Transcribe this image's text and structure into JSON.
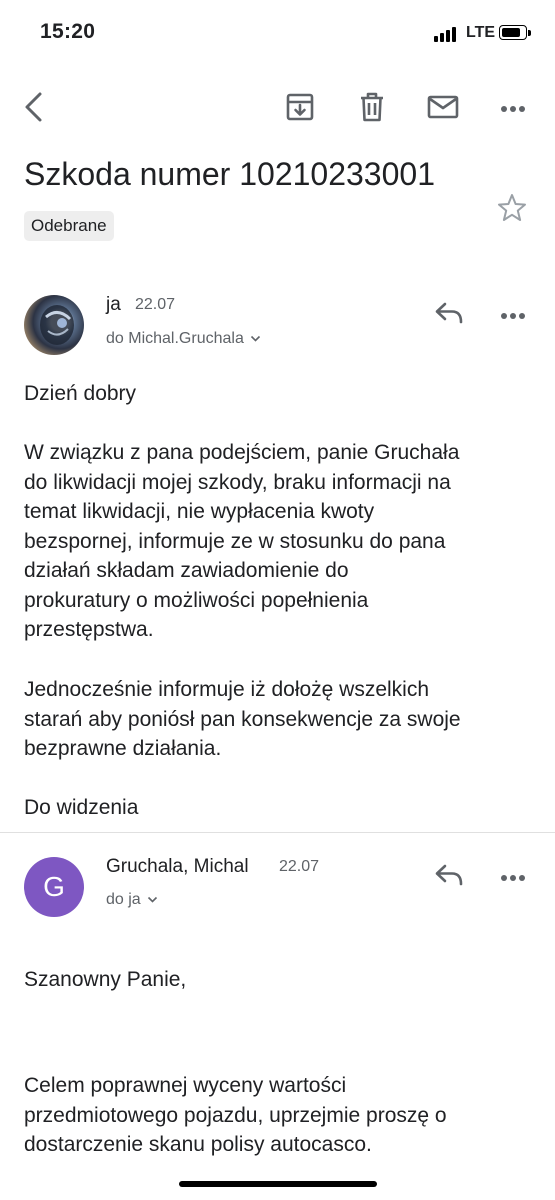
{
  "status_bar": {
    "time": "15:20",
    "network": "LTE",
    "battery_level": 0.85
  },
  "toolbar": {
    "icons": [
      "back-arrow-icon",
      "archive-icon",
      "delete-icon",
      "mark-unread-icon",
      "more-icon"
    ]
  },
  "subject": "Szkoda numer 10210233001",
  "label": "Odebrane",
  "messages": [
    {
      "sender": "ja",
      "date": "22.07",
      "recipient": "do Michal.Gruchala",
      "avatar": "photo",
      "paragraphs": [
        [
          "Dzień dobry"
        ],
        [
          "W związku z pana podejściem, panie Gruchała",
          "do likwidacji mojej szkody, braku informacji na",
          "temat likwidacji, nie wypłacenia kwoty",
          "bezspornej, informuje ze w stosunku do pana",
          "działań składam zawiadomienie do",
          "prokuratury o możliwości popełnienia",
          "przestępstwa."
        ],
        [
          "Jednocześnie informuje iż dołożę wszelkich",
          "starań aby poniósł pan konsekwencje za swoje",
          "bezprawne działania."
        ],
        [
          "Do widzenia"
        ]
      ]
    },
    {
      "sender": "Gruchala, Michal",
      "date": "22.07",
      "recipient": "do ja",
      "avatar_letter": "G",
      "avatar_color": "#7e57c2",
      "paragraphs": [
        [
          "Szanowny Panie,"
        ],
        [
          "Celem poprawnej wyceny wartości",
          "przedmiotowego pojazdu, uprzejmie proszę o",
          "dostarczenie skanu polisy autocasco."
        ]
      ]
    }
  ]
}
